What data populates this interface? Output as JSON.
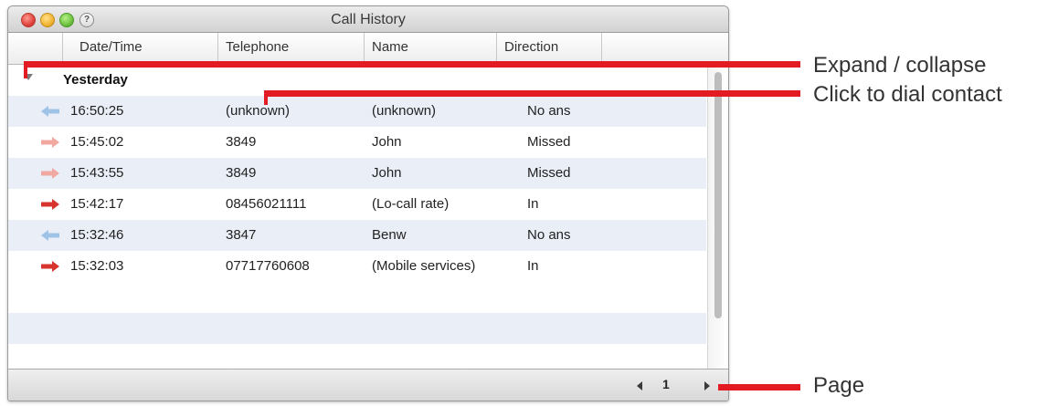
{
  "window": {
    "title": "Call History",
    "help_glyph": "?",
    "columns": [
      "Date/Time",
      "Telephone",
      "Name",
      "Direction"
    ]
  },
  "group": {
    "label": "Yesterday"
  },
  "calls": [
    {
      "time": "16:50:25",
      "telephone": "(unknown)",
      "name": "(unknown)",
      "direction": "No ans",
      "arrow": "incoming-arrow-icon",
      "color": "#9ec3e6"
    },
    {
      "time": "15:45:02",
      "telephone": "3849",
      "name": "John",
      "direction": "Missed",
      "arrow": "missed-arrow-icon",
      "color": "#f0a8a0"
    },
    {
      "time": "15:43:55",
      "telephone": "3849",
      "name": "John",
      "direction": "Missed",
      "arrow": "missed-arrow-icon",
      "color": "#f0a8a0"
    },
    {
      "time": "15:42:17",
      "telephone": "08456021111",
      "name": "(Lo-call rate)",
      "direction": "In",
      "arrow": "inbound-arrow-icon",
      "color": "#d6342c"
    },
    {
      "time": "15:32:46",
      "telephone": "3847",
      "name": "Benw",
      "direction": "No ans",
      "arrow": "incoming-arrow-icon",
      "color": "#9ec3e6"
    },
    {
      "time": "15:32:03",
      "telephone": "07717760608",
      "name": "(Mobile services)",
      "direction": "In",
      "arrow": "inbound-arrow-icon",
      "color": "#d6342c"
    }
  ],
  "pager": {
    "page": "1"
  },
  "callouts": {
    "expand": "Expand / collapse",
    "dial": "Click to dial contact",
    "page": "Page"
  },
  "colors": {
    "callout": "#e31c24",
    "row_alt": "#eaeef7"
  }
}
